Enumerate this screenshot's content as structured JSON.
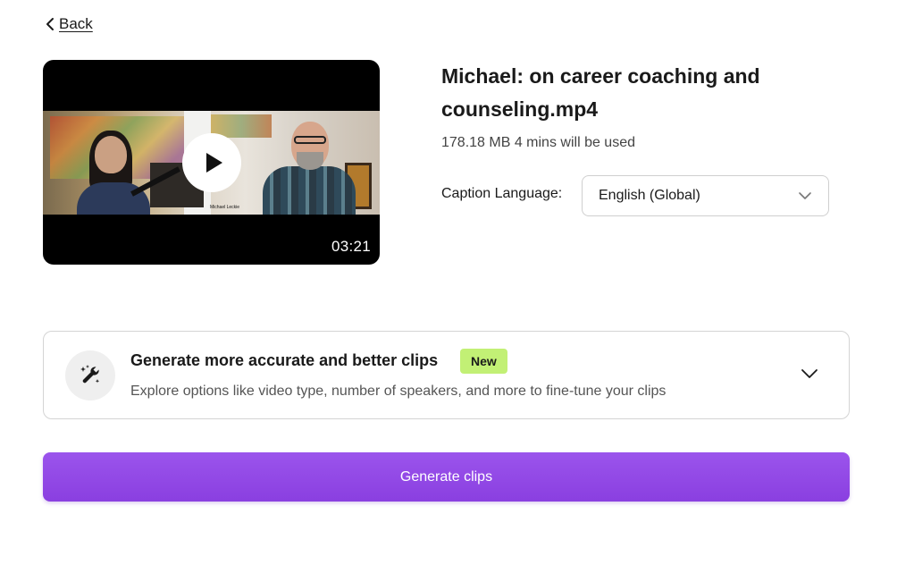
{
  "nav": {
    "back_label": "Back",
    "back_icon": "chevron-left-icon"
  },
  "video": {
    "duration": "03:21",
    "play_icon": "play-icon",
    "speaker_caption": "Michael Leckie"
  },
  "file": {
    "title": "Michael: on career coaching and counseling.mp4",
    "meta": "178.18 MB 4 mins will be used"
  },
  "caption": {
    "label": "Caption Language:",
    "selected": "English (Global)",
    "dropdown_icon": "chevron-down-icon"
  },
  "options_card": {
    "icon": "magic-wrench-icon",
    "title": "Generate more accurate and better clips",
    "badge": "New",
    "description": "Explore options like video type, number of speakers, and more to fine-tune your clips",
    "expand_icon": "chevron-down-icon"
  },
  "actions": {
    "generate_label": "Generate clips"
  },
  "colors": {
    "primary": "#8a3fe0",
    "badge_bg": "#c2f075",
    "border": "#d4d4d4"
  }
}
